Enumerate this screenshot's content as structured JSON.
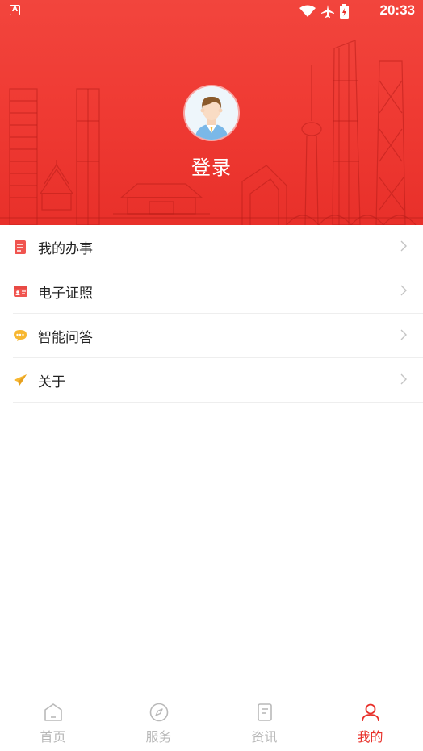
{
  "status_bar": {
    "time": "20:33"
  },
  "profile": {
    "login_label": "登录"
  },
  "menu": {
    "items": [
      {
        "label": "我的办事",
        "icon": "document-icon"
      },
      {
        "label": "电子证照",
        "icon": "id-card-icon"
      },
      {
        "label": "智能问答",
        "icon": "chat-bubble-icon"
      },
      {
        "label": "关于",
        "icon": "paper-plane-icon"
      }
    ]
  },
  "tabbar": {
    "tabs": [
      {
        "label": "首页",
        "icon": "home-icon",
        "active": false
      },
      {
        "label": "服务",
        "icon": "compass-icon",
        "active": false
      },
      {
        "label": "资讯",
        "icon": "news-icon",
        "active": false
      },
      {
        "label": "我的",
        "icon": "user-icon",
        "active": true
      }
    ]
  },
  "colors": {
    "brand": "#e8302a",
    "inactive": "#b9b9b9"
  }
}
